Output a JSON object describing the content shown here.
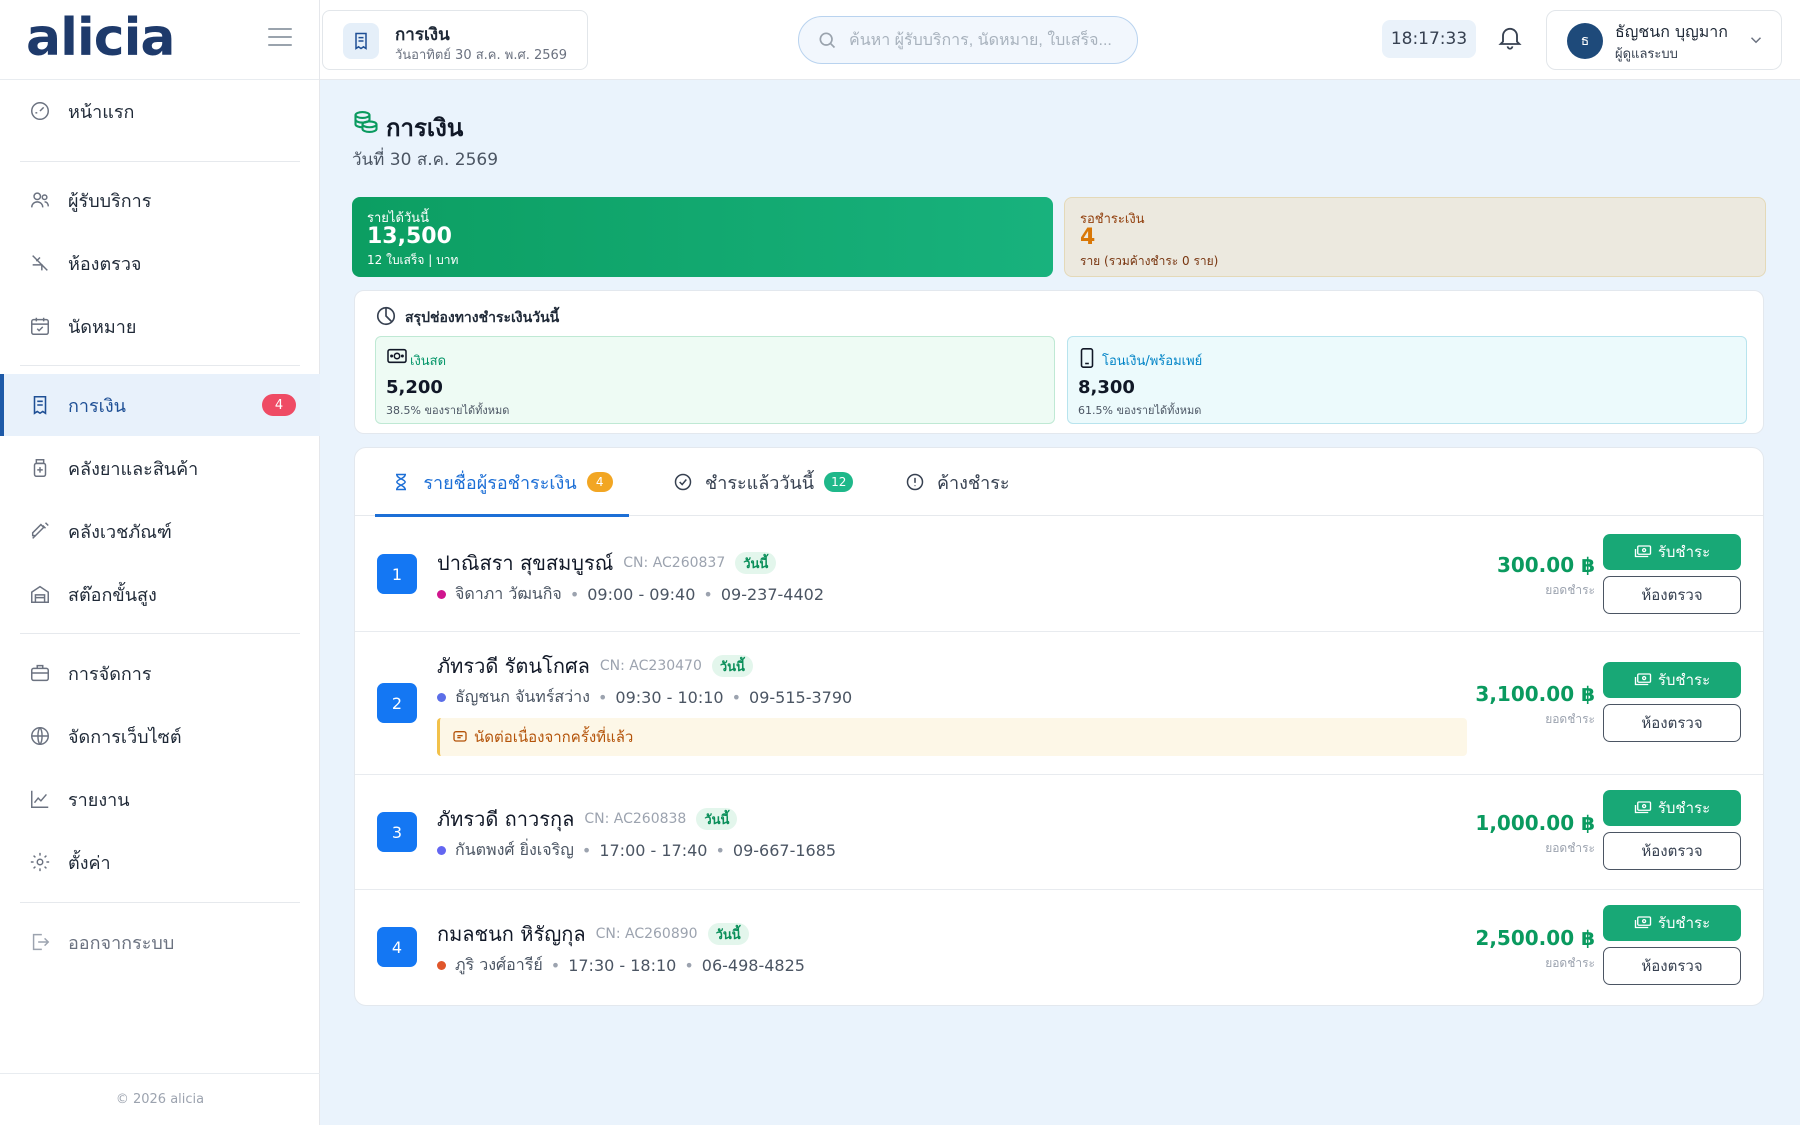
{
  "app": {
    "logo": "alicia",
    "copyright": "© 2026 alicia"
  },
  "sidebar": {
    "items": [
      {
        "label": "หน้าแรก",
        "icon": "dashboard-gauge-icon"
      },
      {
        "label": "ผู้รับบริการ",
        "icon": "users-icon"
      },
      {
        "label": "ห้องตรวจ",
        "icon": "exam-room-icon"
      },
      {
        "label": "นัดหมาย",
        "icon": "calendar-check-icon"
      },
      {
        "label": "การเงิน",
        "icon": "receipt-icon",
        "badge": "4",
        "active": true
      },
      {
        "label": "คลังยาและสินค้า",
        "icon": "medicine-bottle-icon"
      },
      {
        "label": "คลังเวชภัณฑ์",
        "icon": "syringe-icon"
      },
      {
        "label": "สต๊อกขั้นสูง",
        "icon": "warehouse-icon"
      },
      {
        "label": "การจัดการ",
        "icon": "briefcase-icon"
      },
      {
        "label": "จัดการเว็บไซต์",
        "icon": "globe-icon"
      },
      {
        "label": "รายงาน",
        "icon": "chart-line-icon"
      },
      {
        "label": "ตั้งค่า",
        "icon": "gear-icon"
      },
      {
        "label": "ออกจากระบบ",
        "icon": "logout-icon"
      }
    ]
  },
  "header": {
    "page_title": "การเงิน",
    "page_date": "วันอาทิตย์ 30 ส.ค. พ.ศ. 2569",
    "search_placeholder": "ค้นหา ผู้รับบริการ, นัดหมาย, ใบเสร็จ...",
    "clock": "18:17:33",
    "user": {
      "initial": "ธ",
      "name": "ธัญชนก บุญมาก",
      "role": "ผู้ดูแลระบบ"
    }
  },
  "page": {
    "title": "การเงิน",
    "date": "วันที่ 30 ส.ค. 2569",
    "kpi_revenue": {
      "label": "รายได้วันนี้",
      "value": "13,500",
      "sub": "12 ใบเสร็จ | บาท"
    },
    "kpi_pending": {
      "label": "รอชำระเงิน",
      "value": "4",
      "sub": "ราย (รวมค้างชำระ 0 ราย)"
    },
    "channels": {
      "title": "สรุปช่องทางชำระเงินวันนี้",
      "cash": {
        "label": "เงินสด",
        "value": "5,200",
        "sub": "38.5% ของรายได้ทั้งหมด"
      },
      "transfer": {
        "label": "โอนเงิน/พร้อมเพย์",
        "value": "8,300",
        "sub": "61.5% ของรายได้ทั้งหมด"
      }
    },
    "tabs": [
      {
        "label": "รายชื่อผู้รอชำระเงิน",
        "badge": "4",
        "icon": "hourglass-icon",
        "active": true
      },
      {
        "label": "ชำระแล้ววันนี้",
        "badge": "12",
        "icon": "check-circle-icon"
      },
      {
        "label": "ค้างชำระ",
        "icon": "alert-circle-icon"
      }
    ],
    "queue": [
      {
        "no": "1",
        "name": "ปาณิสรา สุขสมบูรณ์",
        "cn": "CN: AC260837",
        "tag": "วันนี้",
        "doctor": "จิดาภา วัฒนกิจ",
        "time": "09:00 - 09:40",
        "phone": "09-237-4402",
        "dot": "#d0168e",
        "amount": "300.00 ฿",
        "amount_label": "ยอดชำระ",
        "pay": "รับชำระ",
        "room": "ห้องตรวจ"
      },
      {
        "no": "2",
        "name": "ภัทรวดี รัตนโกศล",
        "cn": "CN: AC230470",
        "tag": "วันนี้",
        "doctor": "ธัญชนก จันทร์สว่าง",
        "time": "09:30 - 10:10",
        "phone": "09-515-3790",
        "dot": "#5b6ee8",
        "note": "นัดต่อเนื่องจากครั้งที่แล้ว",
        "amount": "3,100.00 ฿",
        "amount_label": "ยอดชำระ",
        "pay": "รับชำระ",
        "room": "ห้องตรวจ"
      },
      {
        "no": "3",
        "name": "ภัทรวดี ถาวรกุล",
        "cn": "CN: AC260838",
        "tag": "วันนี้",
        "doctor": "กันตพงศ์ ยิ่งเจริญ",
        "time": "17:00 - 17:40",
        "phone": "09-667-1685",
        "dot": "#6366f1",
        "amount": "1,000.00 ฿",
        "amount_label": "ยอดชำระ",
        "pay": "รับชำระ",
        "room": "ห้องตรวจ"
      },
      {
        "no": "4",
        "name": "กมลชนก หิรัญกุล",
        "cn": "CN: AC260890",
        "tag": "วันนี้",
        "doctor": "ภูริ วงศ์อารีย์",
        "time": "17:30 - 18:10",
        "phone": "06-498-4825",
        "dot": "#e0562b",
        "amount": "2,500.00 ฿",
        "amount_label": "ยอดชำระ",
        "pay": "รับชำระ",
        "room": "ห้องตรวจ"
      }
    ]
  },
  "colors": {
    "brand": "#1e3a6b",
    "accent": "#1d6fd6",
    "success": "#0a9a5f",
    "danger": "#ef4b64",
    "warning": "#d97706"
  }
}
